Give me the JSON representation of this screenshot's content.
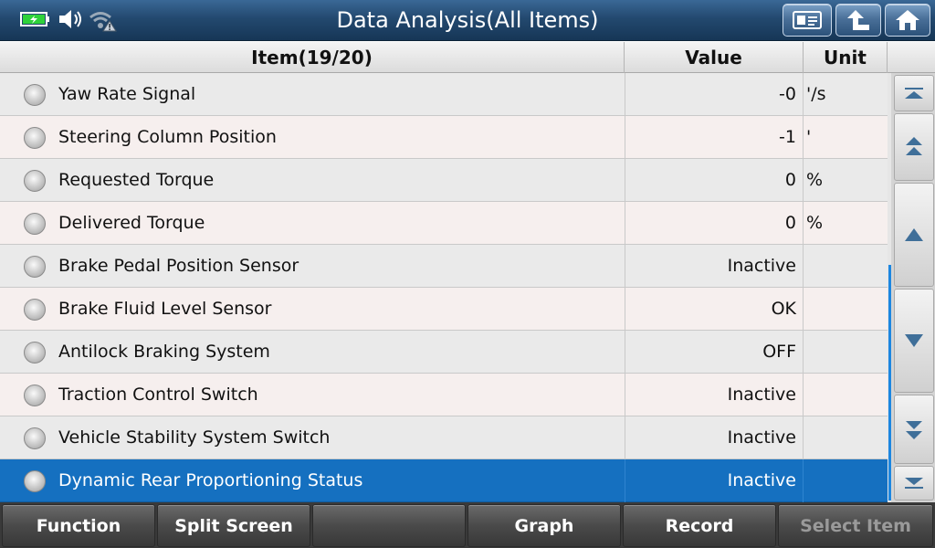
{
  "title": "Data Analysis(All Items)",
  "status": {
    "battery": "battery-charging-icon",
    "sound": "speaker-icon",
    "wifi": "wifi-warning-icon"
  },
  "toolbar": {
    "report_icon": "report-icon",
    "back_icon": "back-arrow-icon",
    "home_icon": "home-icon"
  },
  "table": {
    "headers": {
      "item": "Item(19/20)",
      "value": "Value",
      "unit": "Unit"
    },
    "rows": [
      {
        "name": "Yaw Rate Signal",
        "value": "-0",
        "unit": "'/s"
      },
      {
        "name": "Steering Column Position",
        "value": "-1",
        "unit": "'"
      },
      {
        "name": "Requested Torque",
        "value": "0",
        "unit": "%"
      },
      {
        "name": "Delivered Torque",
        "value": "0",
        "unit": "%"
      },
      {
        "name": "Brake Pedal Position Sensor",
        "value": "Inactive",
        "unit": ""
      },
      {
        "name": "Brake Fluid Level Sensor",
        "value": "OK",
        "unit": ""
      },
      {
        "name": "Antilock Braking System",
        "value": "OFF",
        "unit": ""
      },
      {
        "name": "Traction Control Switch",
        "value": "Inactive",
        "unit": ""
      },
      {
        "name": "Vehicle Stability System Switch",
        "value": "Inactive",
        "unit": ""
      },
      {
        "name": "Dynamic Rear Proportioning Status",
        "value": "Inactive",
        "unit": "",
        "selected": true
      }
    ]
  },
  "bottom_buttons": [
    {
      "label": "Function",
      "enabled": true
    },
    {
      "label": "Split Screen",
      "enabled": true
    },
    {
      "label": "",
      "enabled": true
    },
    {
      "label": "Graph",
      "enabled": true
    },
    {
      "label": "Record",
      "enabled": true
    },
    {
      "label": "Select Item",
      "enabled": false
    }
  ],
  "colors": {
    "title_bar": "#23496f",
    "selected_row": "#1570c0",
    "scroll_thumb": "#1c86e0"
  }
}
